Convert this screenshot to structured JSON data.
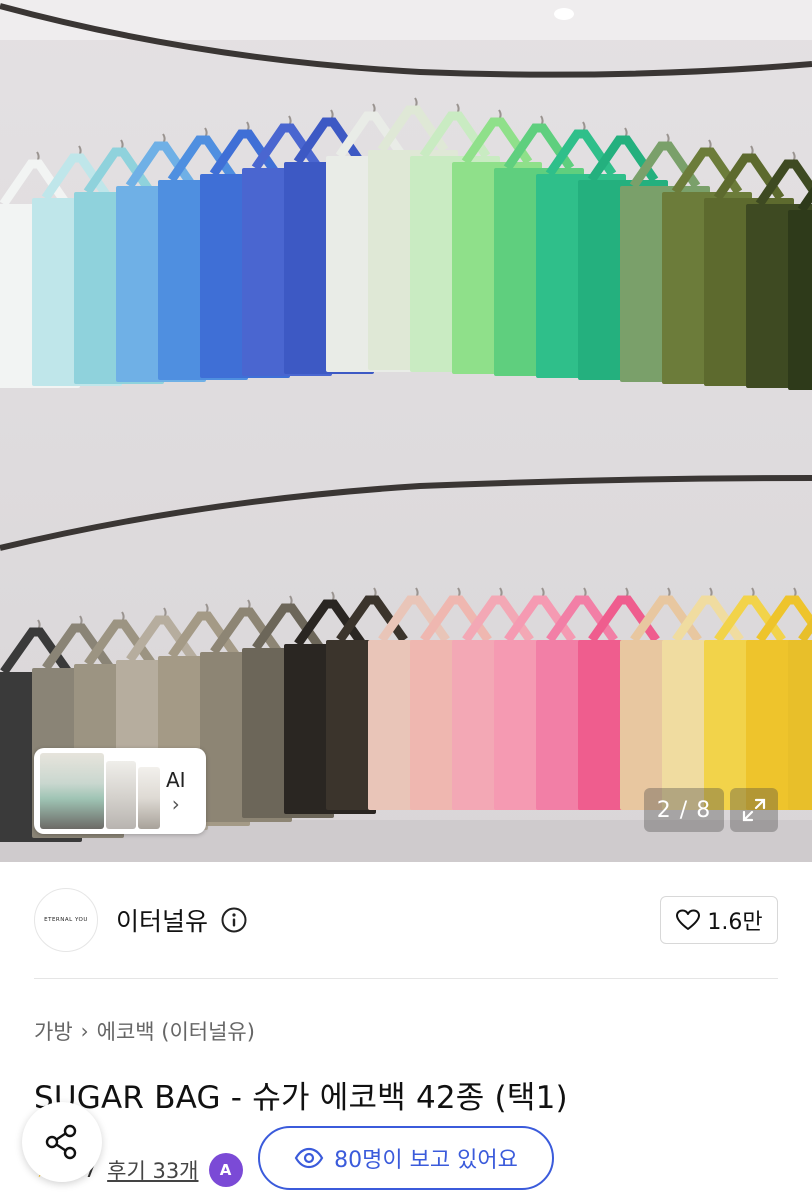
{
  "gallery": {
    "counter": "2 / 8",
    "ai_label": "AI",
    "ai_chevron": "›"
  },
  "shop": {
    "logo_text": "ETERNAL YOU",
    "name": "이터널유",
    "like_count": "1.6만"
  },
  "breadcrumb": {
    "items": [
      "가방",
      "에코백 (이터널유)"
    ],
    "separator": "›"
  },
  "product": {
    "title": "SUGAR BAG - 슈가 에코백 42종 (택1)",
    "rating": "4.7",
    "reviews": "후기 33개",
    "badge_letter": "A"
  },
  "viewers": {
    "text": "80명이 보고 있어요"
  },
  "icons": {
    "info": "info-icon",
    "heart": "heart-icon",
    "expand": "expand-icon",
    "share": "share-icon",
    "eye": "eye-icon",
    "star": "star-icon"
  },
  "colors": {
    "accent": "#3b5bdb",
    "star": "#f5b301",
    "badge": "#7b4ad6"
  }
}
